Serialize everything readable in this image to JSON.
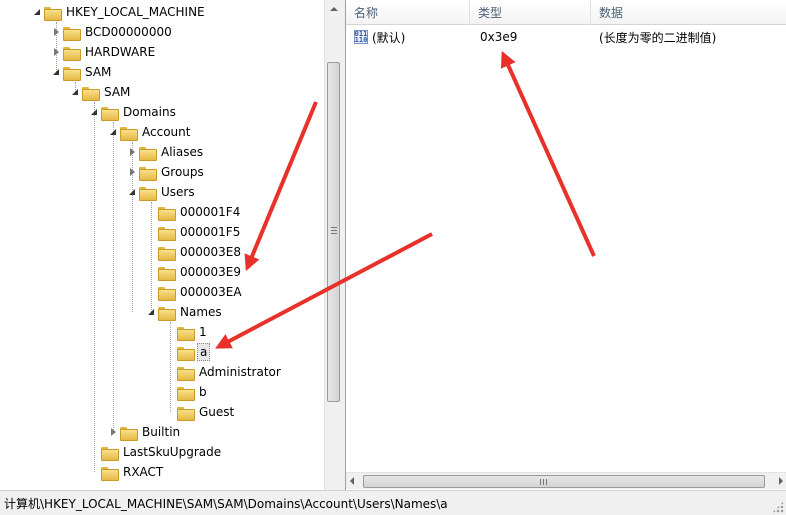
{
  "tree": {
    "nodes": [
      {
        "label": "HKEY_LOCAL_MACHINE",
        "state": "expanded"
      },
      {
        "label": "BCD00000000",
        "state": "collapsed"
      },
      {
        "label": "HARDWARE",
        "state": "collapsed"
      },
      {
        "label": "SAM",
        "state": "expanded"
      },
      {
        "label": "SAM",
        "state": "expanded"
      },
      {
        "label": "Domains",
        "state": "expanded"
      },
      {
        "label": "Account",
        "state": "expanded"
      },
      {
        "label": "Aliases",
        "state": "collapsed"
      },
      {
        "label": "Groups",
        "state": "collapsed"
      },
      {
        "label": "Users",
        "state": "expanded"
      },
      {
        "label": "000001F4",
        "state": "leaf"
      },
      {
        "label": "000001F5",
        "state": "leaf"
      },
      {
        "label": "000003E8",
        "state": "leaf"
      },
      {
        "label": "000003E9",
        "state": "leaf"
      },
      {
        "label": "000003EA",
        "state": "leaf"
      },
      {
        "label": "Names",
        "state": "expanded"
      },
      {
        "label": "1",
        "state": "leaf"
      },
      {
        "label": "a",
        "state": "leaf",
        "selected": true
      },
      {
        "label": "Administrator",
        "state": "leaf"
      },
      {
        "label": "b",
        "state": "leaf"
      },
      {
        "label": "Guest",
        "state": "leaf"
      },
      {
        "label": "Builtin",
        "state": "collapsed"
      },
      {
        "label": "LastSkuUpgrade",
        "state": "leaf"
      },
      {
        "label": "RXACT",
        "state": "leaf"
      }
    ]
  },
  "list": {
    "columns": {
      "name": "名称",
      "type": "类型",
      "data": "数据"
    },
    "rows": [
      {
        "icon": "binary-value-icon",
        "icon_glyph_top": "011",
        "icon_glyph_bottom": "110",
        "name": "(默认)",
        "type": "0x3e9",
        "data": "(长度为零的二进制值)"
      }
    ]
  },
  "status_bar": {
    "path": "计算机\\HKEY_LOCAL_MACHINE\\SAM\\SAM\\Domains\\Account\\Users\\Names\\a"
  },
  "colors": {
    "annotation_arrow": "#e8312a",
    "folder": "#e5b945",
    "selection": "#e8e8e8"
  }
}
